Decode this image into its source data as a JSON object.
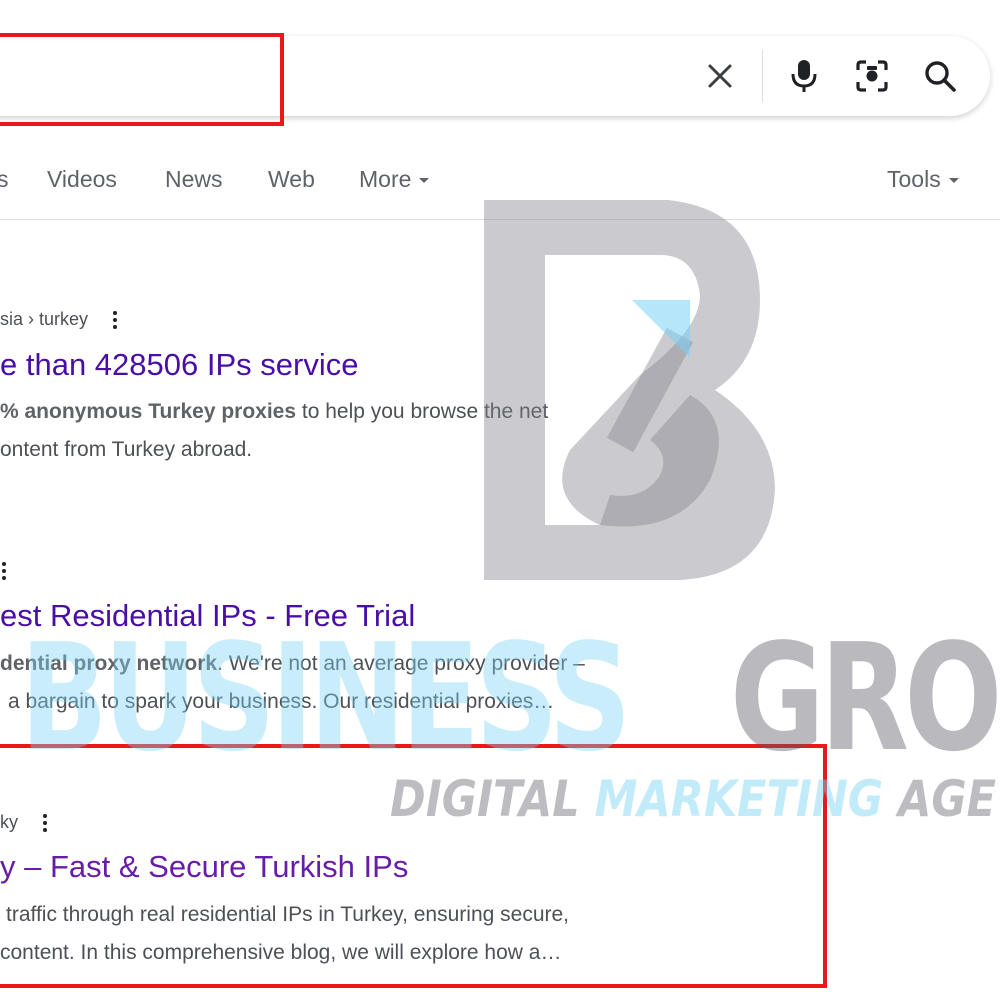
{
  "search": {
    "query": "",
    "clear_icon": "close-icon",
    "voice_icon": "mic-icon",
    "lens_icon": "camera-lens-icon",
    "search_icon": "search-icon"
  },
  "tabs": {
    "items": [
      {
        "label": "s"
      },
      {
        "label": "Videos"
      },
      {
        "label": "News"
      },
      {
        "label": "Web"
      },
      {
        "label": "More"
      }
    ],
    "tools_label": "Tools"
  },
  "results": [
    {
      "cite": "sia › turkey",
      "title": "e than 428506 IPs service",
      "snippet_line1_bold1": "% anonymous Turkey proxies",
      "snippet_line1_rest": " to help you browse the net",
      "snippet_line2": "ontent from Turkey abroad."
    },
    {
      "cite": "",
      "title": "est Residential IPs - Free Trial",
      "snippet_line1_bold1": "dential proxy network",
      "snippet_line1_rest": ". We're not an average proxy provider –",
      "snippet_line2": "a bargain to spark your business. Our residential proxies…"
    },
    {
      "cite": "ky",
      "title": "y – Fast & Secure Turkish IPs",
      "snippet_line1": "traffic through real residential IPs in Turkey, ensuring secure,",
      "snippet_line2": "content. In this comprehensive blog, we will explore how a…"
    }
  ],
  "watermark": {
    "word1": "BUSINESS",
    "word2": "GRO",
    "tag_part1": "DIGITAL ",
    "tag_part2": "MARKETING",
    "tag_part3": " AGE",
    "colors": {
      "blue": "#78d2f5",
      "gray": "#5a5a64"
    }
  },
  "colors": {
    "link": "#4a0ea8",
    "annotation_red": "#e8191c",
    "snippet": "#4d5156"
  }
}
